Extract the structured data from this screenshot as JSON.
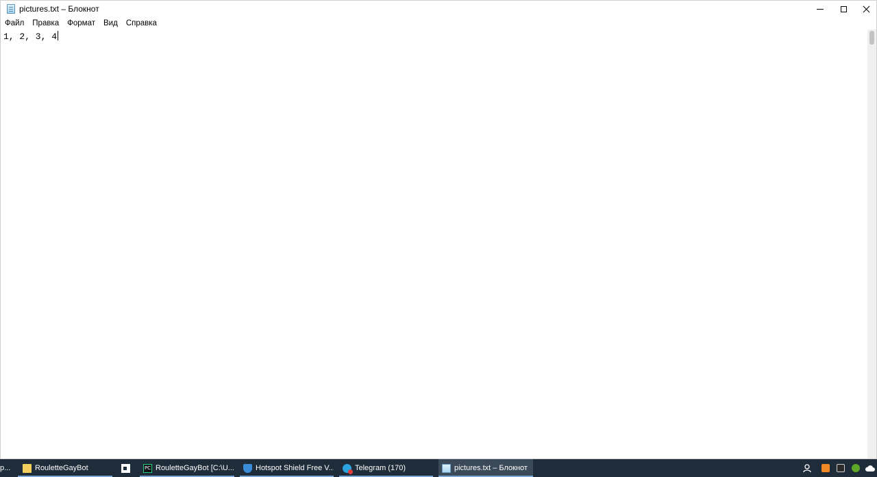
{
  "window": {
    "title": "pictures.txt – Блокнот"
  },
  "menu": {
    "items": [
      "Файл",
      "Правка",
      "Формат",
      "Вид",
      "Справка"
    ]
  },
  "editor": {
    "content": "1, 2, 3, 4"
  },
  "taskbar": {
    "leading_fragment": "p...",
    "items": [
      {
        "label": "RouletteGayBot",
        "icon": "folder-icon"
      },
      {
        "label": "",
        "icon": "store-icon"
      },
      {
        "label": "RouletteGayBot [C:\\U...",
        "icon": "pycharm-icon"
      },
      {
        "label": "Hotspot Shield Free V...",
        "icon": "shield-icon"
      },
      {
        "label": "Telegram (170)",
        "icon": "telegram-icon"
      },
      {
        "label": "pictures.txt – Блокнот",
        "icon": "notepad-icon"
      }
    ],
    "tray": {
      "icons": [
        "people-icon",
        "sublime-icon",
        "epic-games-icon",
        "utorrent-icon",
        "cloud-icon"
      ],
      "colors": {
        "sublime": "#f08a24",
        "epic": "#2b2b2b",
        "utorrent": "#5ea628"
      }
    }
  }
}
